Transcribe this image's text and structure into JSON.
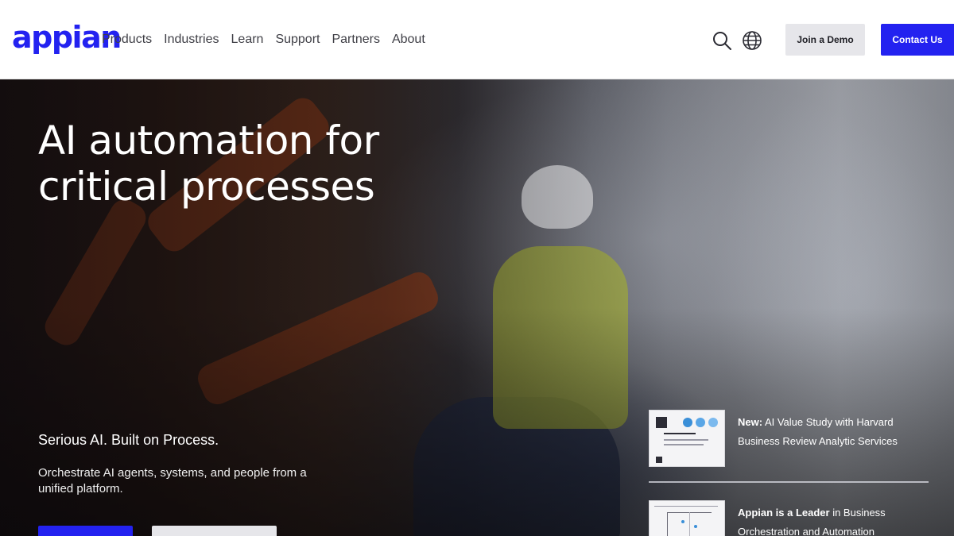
{
  "header": {
    "logo": "appian",
    "nav": [
      "Products",
      "Industries",
      "Learn",
      "Support",
      "Partners",
      "About"
    ],
    "search_icon": "search-icon",
    "globe_icon": "globe-icon",
    "join_demo_label": "Join a Demo",
    "contact_label": "Contact Us"
  },
  "hero": {
    "title_line1": "AI automation for",
    "title_line2": "critical processes",
    "subtitle": "Serious AI. Built on Process.",
    "description": "Orchestrate AI agents, systems, and people from a unified platform."
  },
  "promos": [
    {
      "highlight": "New:",
      "text": " AI Value Study with Harvard Business Review Analytic Services"
    },
    {
      "highlight": "Appian is a Leader",
      "text": " in Business Orchestration and Automation"
    }
  ],
  "colors": {
    "brand": "#2322f0",
    "secondary_button": "#e6e6ea",
    "nav_text": "#3f3f46"
  }
}
